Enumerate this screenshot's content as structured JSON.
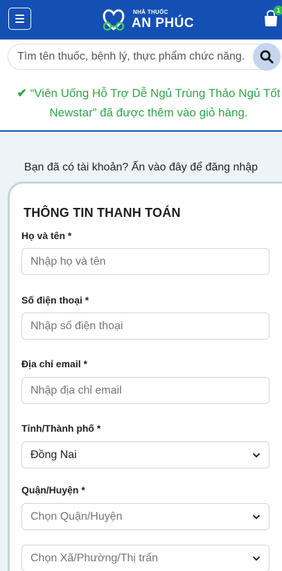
{
  "header": {
    "logo_small": "NHÀ THUỐC",
    "logo_big": "AN PHÚC",
    "cart_count": "1",
    "menu_icon": "hamburger-menu-icon",
    "cart_icon": "shopping-bag-icon"
  },
  "search": {
    "placeholder": "Tìm tên thuốc, bệnh lý, thực phẩm chức năng...",
    "icon": "search-icon"
  },
  "notice": {
    "message": "“Viên Uống Hỗ Trợ Dễ Ngủ Trùng Thảo Ngủ Tốt Newstar” đã được thêm vào giỏ hàng.",
    "icon": "checkmark-icon"
  },
  "login_prompt": "Bạn đã có tài khoản? Ấn vào đây để đăng nhập",
  "checkout": {
    "title": "THÔNG TIN THANH TOÁN",
    "fields": {
      "name": {
        "label": "Họ và tên *",
        "placeholder": "Nhập họ và tên"
      },
      "phone": {
        "label": "Số điện thoại *",
        "placeholder": "Nhập số điện thoại"
      },
      "email": {
        "label": "Địa chỉ email *",
        "placeholder": "Nhập địa chỉ email"
      },
      "province": {
        "label": "Tỉnh/Thành phố *",
        "value": "Đồng Nai"
      },
      "district": {
        "label": "Quận/Huyện *",
        "placeholder": "Chọn Quận/Huyện"
      },
      "ward": {
        "placeholder": "Chọn Xã/Phường/Thị trấn"
      }
    }
  },
  "colors": {
    "header_bg": "#1450b4",
    "success_green": "#2fa54a",
    "badge_green": "#2ebd4d",
    "page_bg": "#eef3f8"
  }
}
